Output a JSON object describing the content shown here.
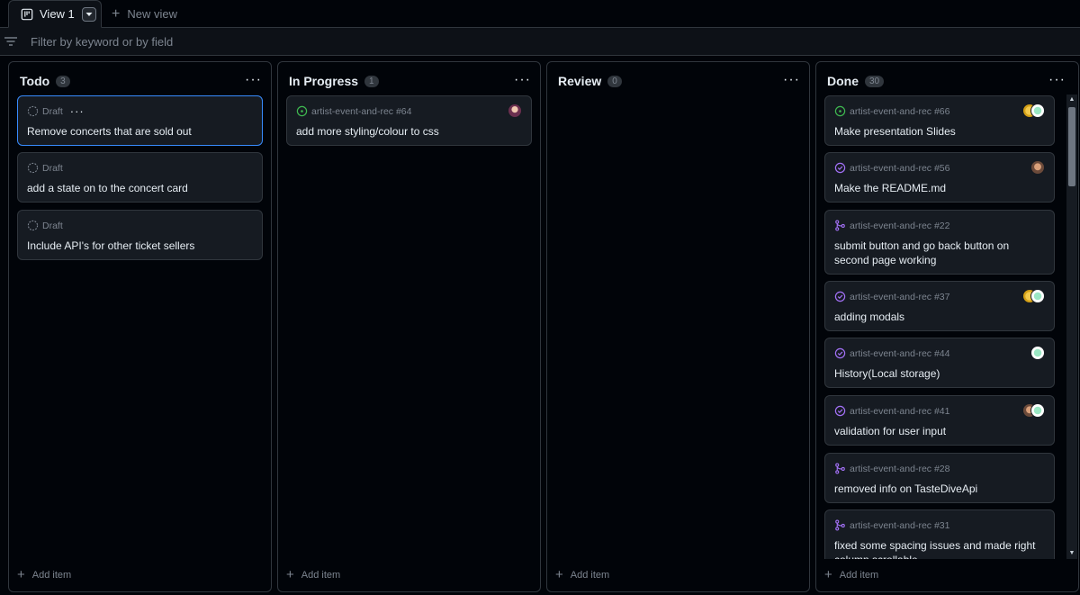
{
  "tabs": {
    "active_label": "View 1",
    "new_view_label": "New view"
  },
  "filter": {
    "placeholder": "Filter by keyword or by field"
  },
  "add_item_label": "Add item",
  "columns": [
    {
      "title": "Todo",
      "count": "3",
      "cards": [
        {
          "meta": "Draft",
          "title": "Remove concerts that are sold out"
        },
        {
          "meta": "Draft",
          "title": "add a state on to the concert card"
        },
        {
          "meta": "Draft",
          "title": "Include API's for other ticket sellers"
        }
      ]
    },
    {
      "title": "In Progress",
      "count": "1",
      "cards": [
        {
          "meta": "artist-event-and-rec #64",
          "title": "add more styling/colour to css"
        }
      ]
    },
    {
      "title": "Review",
      "count": "0",
      "cards": []
    },
    {
      "title": "Done",
      "count": "30",
      "cards": [
        {
          "meta": "artist-event-and-rec #66",
          "title": "Make presentation Slides"
        },
        {
          "meta": "artist-event-and-rec #56",
          "title": "Make the README.md"
        },
        {
          "meta": "artist-event-and-rec #22",
          "title": "submit button and go back button on second page working"
        },
        {
          "meta": "artist-event-and-rec #37",
          "title": "adding modals"
        },
        {
          "meta": "artist-event-and-rec #44",
          "title": "History(Local storage)"
        },
        {
          "meta": "artist-event-and-rec #41",
          "title": "validation for user input"
        },
        {
          "meta": "artist-event-and-rec #28",
          "title": "removed info on TasteDiveApi"
        },
        {
          "meta": "artist-event-and-rec #31",
          "title": "fixed some spacing issues and made right column scrollable"
        }
      ]
    }
  ],
  "icons": {
    "draft": "draft-circle-icon",
    "open": "issue-opened-icon",
    "closed": "issue-closed-icon",
    "merged": "git-merge-icon"
  },
  "colors": {
    "open": "#3fb950",
    "closed_merged": "#a371f7",
    "focus": "#388bfd"
  }
}
